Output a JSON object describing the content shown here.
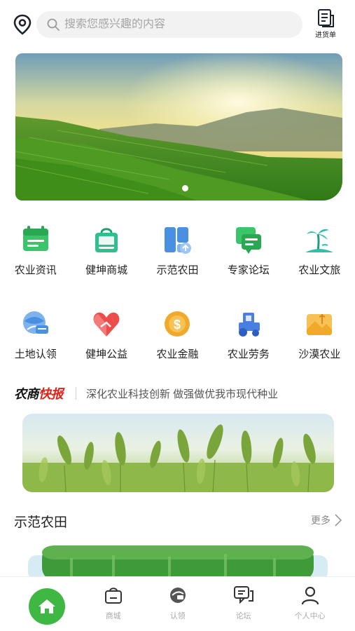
{
  "header": {
    "search_placeholder": "搜索您感兴趣的内容",
    "cart_label": "进货单"
  },
  "banner": {
    "description_icon": "landscape-image",
    "dots": 1
  },
  "grid_row1": [
    {
      "label": "农业资讯",
      "icon": "news-icon",
      "color": "#3cc46a"
    },
    {
      "label": "健坤商城",
      "icon": "shopping-bag-icon",
      "color": "#2fbf8f"
    },
    {
      "label": "示范农田",
      "icon": "field-icon",
      "color": "#4a90e2"
    },
    {
      "label": "专家论坛",
      "icon": "chat-icon",
      "color": "#3cc46a"
    },
    {
      "label": "农业文旅",
      "icon": "island-icon",
      "color": "#2fbfa8"
    }
  ],
  "grid_row2": [
    {
      "label": "土地认领",
      "icon": "land-claim-icon",
      "color": "#4a90e2"
    },
    {
      "label": "健坤公益",
      "icon": "heart-icon",
      "color": "#ee4b4b"
    },
    {
      "label": "农业金融",
      "icon": "coin-icon",
      "color": "#f0a92a"
    },
    {
      "label": "农业劳务",
      "icon": "tractor-icon",
      "color": "#4a7fe2"
    },
    {
      "label": "沙漠农业",
      "icon": "desert-icon",
      "color": "#f0a92a"
    }
  ],
  "news": {
    "brand_part1": "农商",
    "brand_part2": "快报",
    "headline": "深化农业科技创新 做强做优我市现代种业"
  },
  "section": {
    "title": "示范农田",
    "more": "更多"
  },
  "tabbar": [
    {
      "label": "首页",
      "icon": "home-icon"
    },
    {
      "label": "商城",
      "icon": "shop-icon"
    },
    {
      "label": "认领",
      "icon": "claim-icon"
    },
    {
      "label": "论坛",
      "icon": "forum-icon"
    },
    {
      "label": "个人中心",
      "icon": "user-icon"
    }
  ],
  "colors": {
    "accent_green": "#3fb743",
    "news_red": "#e0221b"
  }
}
